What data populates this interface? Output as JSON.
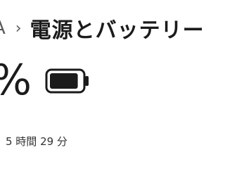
{
  "header": {
    "breadcrumb_parent": "A",
    "separator": "›",
    "title": "電源とバッテリー"
  },
  "battery": {
    "percent_text": "%",
    "charge_fraction": 0.9,
    "icon": "battery-icon",
    "remaining_text": "5 時間 29 分"
  }
}
